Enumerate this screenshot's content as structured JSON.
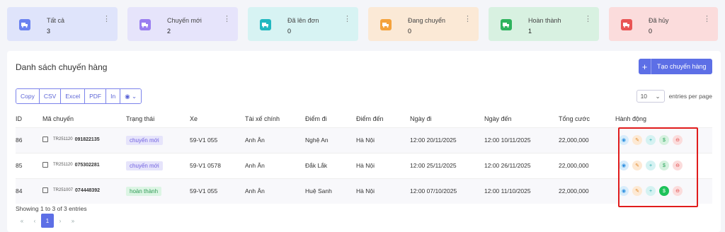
{
  "cards": [
    {
      "label": "Tất cả",
      "count": "3",
      "bg": "#dfe4fb",
      "icon_bg": "#6a82f0",
      "icon": "truck-icon"
    },
    {
      "label": "Chuyến mới",
      "count": "2",
      "bg": "#e6e4fb",
      "icon_bg": "#9a7ef0",
      "icon": "truck-icon"
    },
    {
      "label": "Đã lên đơn",
      "count": "0",
      "bg": "#d7f3f3",
      "icon_bg": "#22b8c0",
      "icon": "truck-icon"
    },
    {
      "label": "Đang chuyển",
      "count": "0",
      "bg": "#fbe9d6",
      "icon_bg": "#f4a23c",
      "icon": "truck-icon"
    },
    {
      "label": "Hoàn thành",
      "count": "1",
      "bg": "#d8f1e1",
      "icon_bg": "#2fb35e",
      "icon": "truck-icon"
    },
    {
      "label": "Đã hủy",
      "count": "0",
      "bg": "#fbdcdc",
      "icon_bg": "#e95555",
      "icon": "truck-icon"
    }
  ],
  "panel": {
    "title": "Danh sách chuyến hàng",
    "create_label": "Tạo chuyến hàng"
  },
  "export": [
    "Copy",
    "CSV",
    "Excel",
    "PDF",
    "In"
  ],
  "page_size": {
    "value": "10",
    "suffix": "entries per page"
  },
  "table": {
    "headers": [
      "ID",
      "Mã chuyến",
      "Trạng thái",
      "Xe",
      "Tài xế chính",
      "Điểm đi",
      "Điểm đến",
      "Ngày đi",
      "Ngày đến",
      "Tổng cước",
      "Hành động"
    ],
    "rows": [
      {
        "id": "86",
        "code_pre": "TR251120",
        "code_num": "091822135",
        "status": "chuyến mới",
        "vehicle": "59-V1 055",
        "driver": "Anh Ân",
        "from": "Nghệ An",
        "to": "Hà Nội",
        "depart": "12:00 20/11/2025",
        "arrive": "12:00 10/11/2025",
        "total": "22,000,000"
      },
      {
        "id": "85",
        "code_pre": "TR251120",
        "code_num": "075302281",
        "status": "chuyến mới",
        "vehicle": "59-V1 0578",
        "driver": "Anh Ân",
        "from": "Đắk Lắk",
        "to": "Hà Nội",
        "depart": "12:00 25/11/2025",
        "arrive": "12:00 26/11/2025",
        "total": "22,000,000"
      },
      {
        "id": "84",
        "code_pre": "TR251007",
        "code_num": "074448392",
        "status": "hoàn thành",
        "vehicle": "59-V1 055",
        "driver": "Anh Ân",
        "from": "Huệ Sanh",
        "to": "Hà Nội",
        "depart": "12:00 07/10/2025",
        "arrive": "12:00 11/10/2025",
        "total": "22,000,000"
      }
    ]
  },
  "footer": {
    "info": "Showing 1 to 3 of 3 entries",
    "pager": [
      "«",
      "‹",
      "1",
      "›",
      "»"
    ]
  }
}
